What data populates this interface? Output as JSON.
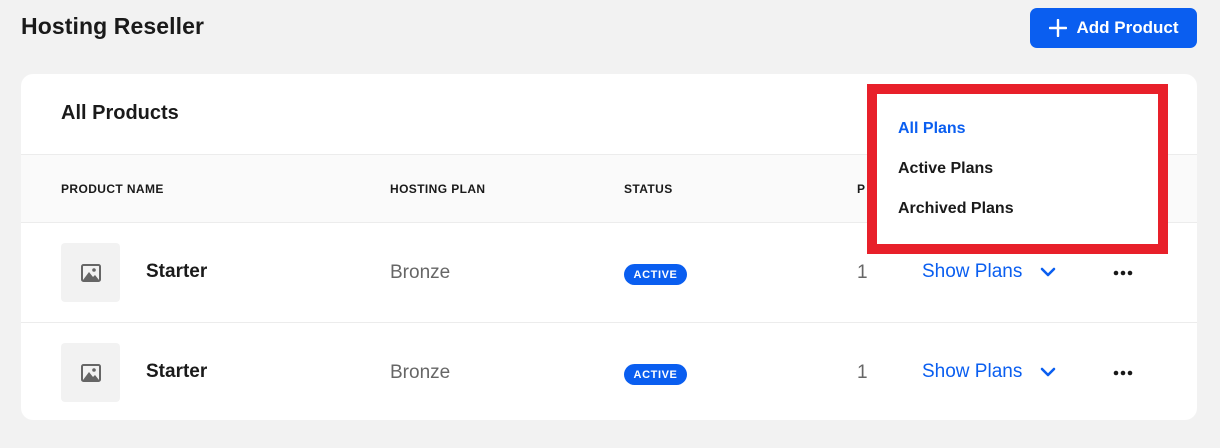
{
  "header": {
    "title": "Hosting Reseller",
    "add_button_label": "Add Product",
    "add_button_icon": "plus-icon"
  },
  "card": {
    "title": "All Products",
    "columns": [
      "PRODUCT NAME",
      "HOSTING PLAN",
      "STATUS",
      "P"
    ]
  },
  "rows": [
    {
      "name": "Starter",
      "plan": "Bronze",
      "status": "ACTIVE",
      "count": "1",
      "action": "Show Plans",
      "thumb_icon": "image-placeholder-icon"
    },
    {
      "name": "Starter",
      "plan": "Bronze",
      "status": "ACTIVE",
      "count": "1",
      "action": "Show Plans",
      "thumb_icon": "image-placeholder-icon"
    }
  ],
  "filter_dropdown": {
    "items": [
      "All Plans",
      "Active Plans",
      "Archived Plans"
    ],
    "selected": "All Plans",
    "highlight_color": "#e8202a"
  },
  "colors": {
    "accent": "#0a5ef0",
    "background": "#f2f2f2"
  }
}
